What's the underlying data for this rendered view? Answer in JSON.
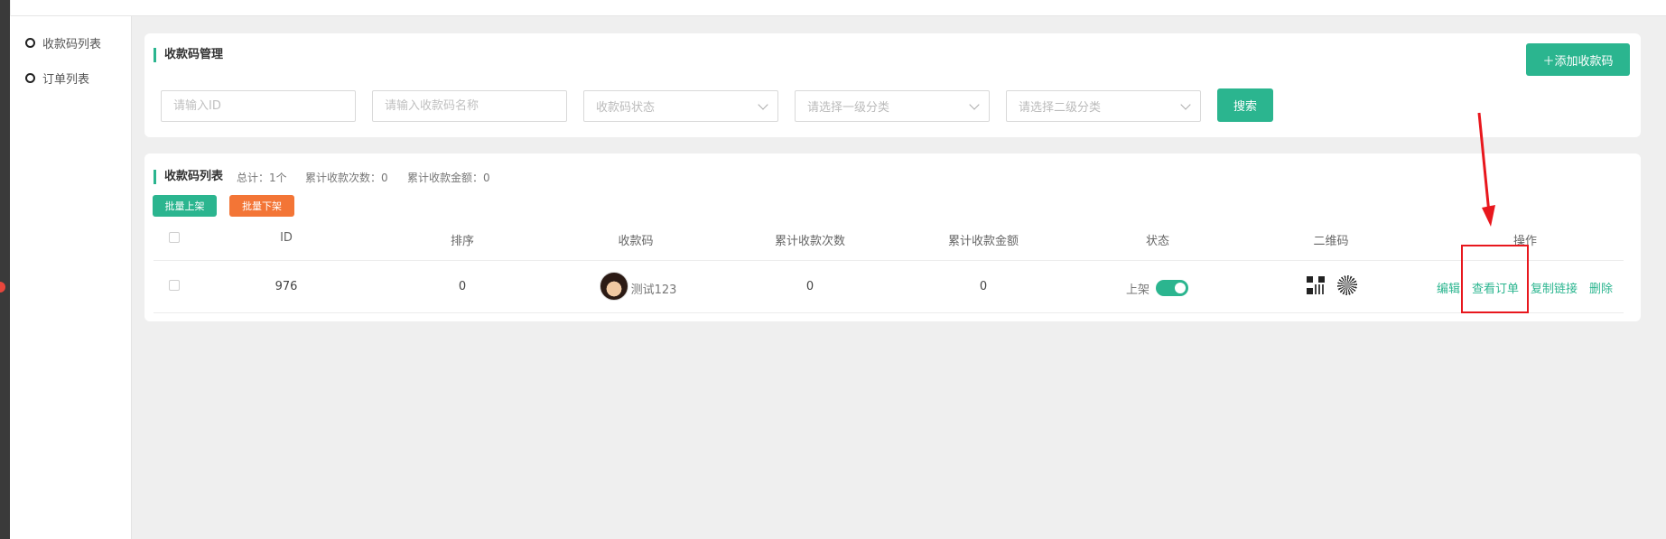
{
  "sidebar": {
    "items": [
      {
        "label": "收款码列表"
      },
      {
        "label": "订单列表"
      }
    ]
  },
  "filter_card": {
    "title": "收款码管理",
    "add_button": "＋添加收款码",
    "id_placeholder": "请输入ID",
    "name_placeholder": "请输入收款码名称",
    "status_select": "收款码状态",
    "category1_select": "请选择一级分类",
    "category2_select": "请选择二级分类",
    "search_button": "搜索"
  },
  "list_card": {
    "title": "收款码列表",
    "total": "总计：1个",
    "total_count": "累计收款次数：0",
    "total_amount": "累计收款金额：0",
    "batch_on": "批量上架",
    "batch_off": "批量下架",
    "columns": [
      "ID",
      "排序",
      "收款码",
      "累计收款次数",
      "累计收款金额",
      "状态",
      "二维码",
      "操作"
    ],
    "rows": [
      {
        "id": "976",
        "sort": "0",
        "name": "测试123",
        "count": "0",
        "amount": "0",
        "status": "上架",
        "actions": {
          "edit": "编辑",
          "view_orders": "查看订单",
          "copy_link": "复制链接",
          "delete": "删除"
        }
      }
    ]
  },
  "colors": {
    "accent": "#2bb58f",
    "orange": "#f37536",
    "annotation": "#e8171d"
  }
}
